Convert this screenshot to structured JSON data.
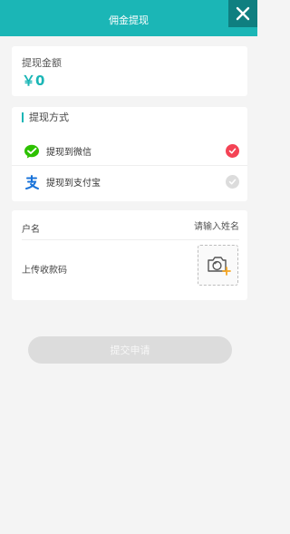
{
  "header": {
    "title": "佣金提现",
    "close_icon": "close-icon"
  },
  "amount": {
    "label": "提现金额",
    "value": "￥0"
  },
  "method": {
    "title": "提现方式",
    "options": [
      {
        "label": "提现到微信",
        "icon": "wechat-icon",
        "selected": true
      },
      {
        "label": "提现到支付宝",
        "icon": "alipay-icon",
        "selected": false
      }
    ]
  },
  "account": {
    "name_label": "户名",
    "name_placeholder": "请输入姓名",
    "name_value": "",
    "qr_label": "上传收款码",
    "upload_icon": "camera-add-icon"
  },
  "submit": {
    "label": "提交申请"
  },
  "colors": {
    "primary": "#1bb6b6",
    "selected_check": "#f44355",
    "disabled": "#dcdcdc"
  }
}
